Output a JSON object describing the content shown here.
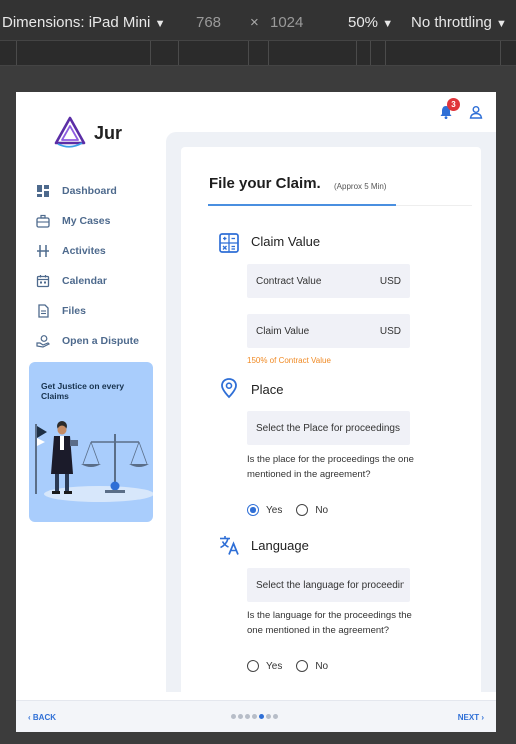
{
  "devtools": {
    "dimensions_label": "Dimensions: iPad Mini",
    "width": "768",
    "times": "×",
    "height": "1024",
    "zoom": "50%",
    "throttling": "No throttling"
  },
  "header": {
    "brand": "Jur",
    "notification_count": "3",
    "colors": {
      "accent": "#2f6fd6",
      "badge": "#e0353b"
    }
  },
  "sidebar": {
    "items": [
      {
        "label": "Dashboard",
        "icon": "dashboard-icon"
      },
      {
        "label": "My Cases",
        "icon": "briefcase-icon"
      },
      {
        "label": "Activites",
        "icon": "activity-icon"
      },
      {
        "label": "Calendar",
        "icon": "calendar-icon"
      },
      {
        "label": "Files",
        "icon": "file-icon"
      },
      {
        "label": "Open a Dispute",
        "icon": "hand-icon"
      }
    ],
    "promo_title": "Get Justice on every Claims"
  },
  "form": {
    "title": "File your Claim.",
    "subtitle": "(Approx 5 Min)",
    "claim_value": {
      "title": "Claim Value",
      "contract_placeholder": "Contract Value",
      "contract_currency": "USD",
      "claim_placeholder": "Claim Value",
      "claim_currency": "USD",
      "hint": "150% of Contract Value"
    },
    "place": {
      "title": "Place",
      "select_text": "Select the Place for proceedings",
      "question": "Is the place for the proceedings the one mentioned in the agreement?",
      "yes": "Yes",
      "no": "No",
      "selected": "Yes"
    },
    "language": {
      "title": "Language",
      "select_text": "Select the language for proceedings",
      "question": "Is the language for the proceedings the one mentioned in the agreement?",
      "yes": "Yes",
      "no": "No",
      "selected": "none"
    }
  },
  "footer": {
    "back": "BACK",
    "next": "NEXT",
    "steps_total": 7,
    "active_step": 5
  }
}
